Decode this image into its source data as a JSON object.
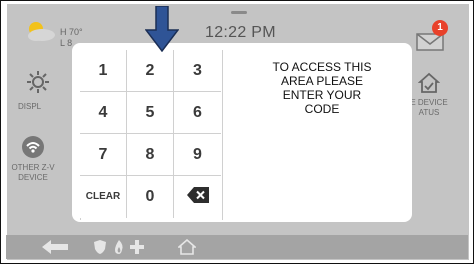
{
  "header": {
    "temp_high": "H 70°",
    "temp_low": "L 8",
    "time": "12:22 PM",
    "message_count": "1"
  },
  "tiles": {
    "display": "DISPL",
    "zwave_line1": "OTHER Z-V",
    "zwave_line2": "DEVICE",
    "status_line1": "E DEVICE",
    "status_line2": "ATUS"
  },
  "keypad": {
    "keys": [
      "1",
      "2",
      "3",
      "4",
      "5",
      "6",
      "7",
      "8",
      "9",
      "CLEAR",
      "0",
      ""
    ]
  },
  "dialog": {
    "message": "TO ACCESS THIS\nAREA PLEASE\nENTER YOUR\nCODE"
  },
  "colors": {
    "badge": "#e8412a",
    "arrow": "#2f5496",
    "screen_bg": "#c4c4c4"
  }
}
